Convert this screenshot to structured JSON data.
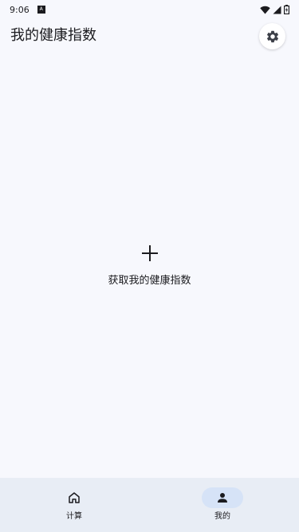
{
  "status_bar": {
    "time": "9:06",
    "notification_icon": "A"
  },
  "header": {
    "title": "我的健康指数",
    "settings_icon": "gear-icon"
  },
  "main": {
    "add_icon": "plus-icon",
    "add_label": "获取我的健康指数"
  },
  "bottom_nav": {
    "items": [
      {
        "label": "计算",
        "icon": "home-icon",
        "active": false
      },
      {
        "label": "我的",
        "icon": "person-icon",
        "active": true
      }
    ]
  },
  "colors": {
    "background": "#f7f8fd",
    "nav_background": "#e8edf5",
    "active_indicator": "#d6e3f7",
    "text": "#1b1b1f"
  }
}
